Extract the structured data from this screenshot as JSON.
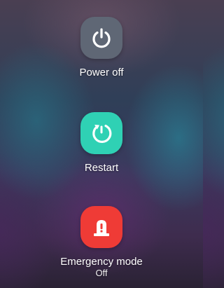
{
  "power_menu": {
    "power_off": {
      "label": "Power off",
      "icon": "power-icon",
      "color": "#5f6775"
    },
    "restart": {
      "label": "Restart",
      "icon": "restart-icon",
      "color": "#2fd1b4"
    },
    "emergency_mode": {
      "label": "Emergency mode",
      "status": "Off",
      "icon": "emergency-siren-icon",
      "color": "#ef3b36"
    }
  }
}
